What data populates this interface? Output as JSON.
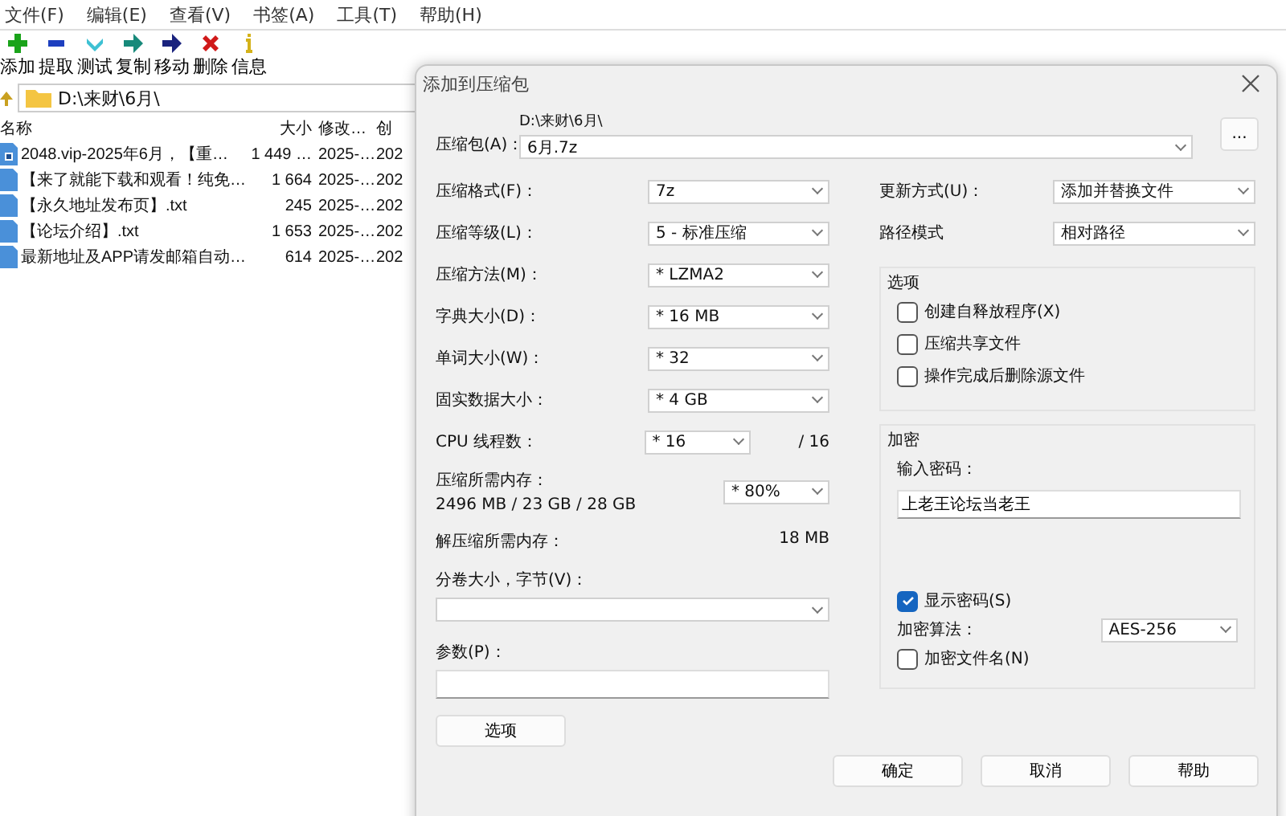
{
  "menu": [
    "文件(F)",
    "编辑(E)",
    "查看(V)",
    "书签(A)",
    "工具(T)",
    "帮助(H)"
  ],
  "toolbar": [
    {
      "kind": "add",
      "label": "添加"
    },
    {
      "kind": "extract",
      "label": "提取"
    },
    {
      "kind": "test",
      "label": "测试"
    },
    {
      "kind": "copy",
      "label": "复制"
    },
    {
      "kind": "move",
      "label": "移动"
    },
    {
      "kind": "delete",
      "label": "删除"
    },
    {
      "kind": "info",
      "label": "信息"
    }
  ],
  "path": "D:\\来财\\6月\\",
  "file_list": {
    "columns": [
      "名称",
      "大小",
      "修改…",
      "创"
    ],
    "rows": [
      {
        "kind": "archive",
        "cells": [
          "2048.vip-2025年6月，【重…",
          "1 449 …",
          "2025-…",
          "202"
        ]
      },
      {
        "kind": "text",
        "cells": [
          "【来了就能下载和观看！纯免…",
          "1 664",
          "2025-…",
          "202"
        ]
      },
      {
        "kind": "text",
        "cells": [
          "【永久地址发布页】.txt",
          "245",
          "2025-…",
          "202"
        ]
      },
      {
        "kind": "text",
        "cells": [
          "【论坛介绍】.txt",
          "1 653",
          "2025-…",
          "202"
        ]
      },
      {
        "kind": "text",
        "cells": [
          "最新地址及APP请发邮箱自动…",
          "614",
          "2025-…",
          "202"
        ]
      }
    ]
  },
  "dialog": {
    "title": "添加到压缩包",
    "archive": {
      "label": "压缩包(A)：",
      "folder": "D:\\来财\\6月\\",
      "value": "6月.7z",
      "browse": "..."
    },
    "left_fields": [
      {
        "kind": "select",
        "label": "压缩格式(F)：",
        "value": "7z"
      },
      {
        "kind": "select",
        "label": "压缩等级(L)：",
        "value": "5 - 标准压缩"
      },
      {
        "kind": "select",
        "label": "压缩方法(M)：",
        "value": "*  LZMA2"
      },
      {
        "kind": "select",
        "label": "字典大小(D)：",
        "value": "*  16 MB"
      },
      {
        "kind": "select",
        "label": "单词大小(W)：",
        "value": "*  32"
      },
      {
        "kind": "select",
        "label": "固实数据大小：",
        "value": "*  4 GB"
      },
      {
        "kind": "threads",
        "label": "CPU 线程数：",
        "value": "*  16",
        "suffix": "/ 16"
      },
      {
        "kind": "memory",
        "label": "压缩所需内存：",
        "detail": "2496 MB / 23 GB / 28 GB",
        "value": "* 80%"
      },
      {
        "kind": "info",
        "label": "解压缩所需内存：",
        "value": "18 MB"
      }
    ],
    "volume_label": "分卷大小，字节(V)：",
    "params_label": "参数(P)：",
    "options_button": "选项",
    "update": {
      "label": "更新方式(U)：",
      "value": "添加并替换文件"
    },
    "path_mode": {
      "label": "路径模式",
      "value": "相对路径"
    },
    "options": {
      "title": "选项",
      "items": [
        {
          "label": "创建自释放程序(X)",
          "checked": false
        },
        {
          "label": "压缩共享文件",
          "checked": false
        },
        {
          "label": "操作完成后删除源文件",
          "checked": false
        }
      ]
    },
    "encryption": {
      "title": "加密",
      "password_label": "输入密码：",
      "password": "上老王论坛当老王",
      "show_password": {
        "label": "显示密码(S)",
        "checked": true
      },
      "method_label": "加密算法：",
      "method": "AES-256",
      "encrypt_names": {
        "label": "加密文件名(N)",
        "checked": false
      }
    },
    "buttons": [
      "确定",
      "取消",
      "帮助"
    ]
  }
}
